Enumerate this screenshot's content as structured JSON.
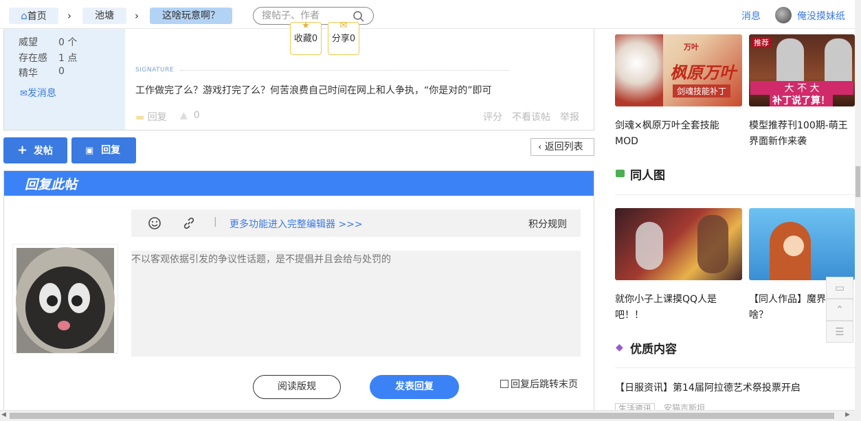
{
  "breadcrumb": {
    "home": "首页",
    "forum": "池塘",
    "thread": "这啥玩意啊？"
  },
  "search": {
    "placeholder": "搜帖子、作者"
  },
  "header": {
    "messages": "消息",
    "username": "俺没摸妹纸"
  },
  "user_stats": [
    {
      "label": "威望",
      "value": "0 个"
    },
    {
      "label": "存在感",
      "value": "1 点"
    },
    {
      "label": "精华",
      "value": "0"
    }
  ],
  "send_message": "发消息",
  "post_actions": {
    "favorite": "收藏0",
    "share": "分享0"
  },
  "signature": {
    "label": "SIGNATURE",
    "text": "工作做完了么？游戏打完了么？何苦浪费自己时间在网上和人争执，“你是对的”即可"
  },
  "post_footer": {
    "reply": "回复",
    "like_count": "0",
    "rate": "评分",
    "hide_author": "不看该帖",
    "report": "举报"
  },
  "buttons": {
    "new_post": "发帖",
    "reply": "回复",
    "back_to_list": "返回列表"
  },
  "reply_box": {
    "title": "回复此帖",
    "editor_link": "更多功能进入完整编辑器 >>>",
    "points_rules": "积分规则",
    "placeholder": "不以客观依据引发的争议性话题，是不提倡并且会给与处罚的",
    "read_rules": "阅读版规",
    "submit": "发表回复",
    "jump_last": "回复后跳转末页"
  },
  "sidebar": {
    "top_cards": [
      {
        "caption": "剑魂×枫原万叶全套技能MOD",
        "overlay_a": "万叶",
        "overlay_b": "枫原万叶",
        "overlay_c": "剑魂技能补丁"
      },
      {
        "caption": "模型推荐刊100期-萌王界面新作来袭",
        "overlay_a": "推荐",
        "overlay_b": "大 不 大",
        "overlay_c": "补丁说了算！"
      }
    ],
    "fan_art_title": "同人图",
    "fan_art_cards": [
      {
        "caption": "就你小子上课摸QQ人是吧！！"
      },
      {
        "caption": "【同人作品】魔界啥？"
      }
    ],
    "quality_title": "优质内容",
    "quality_item": "【日服资讯】第14届阿拉德艺术祭投票开启",
    "quality_tag": "生活资讯",
    "quality_author": "安猫吉斯坦"
  },
  "colors": {
    "accent": "#3b82f6",
    "crumb_active": "#b3d3f5"
  }
}
